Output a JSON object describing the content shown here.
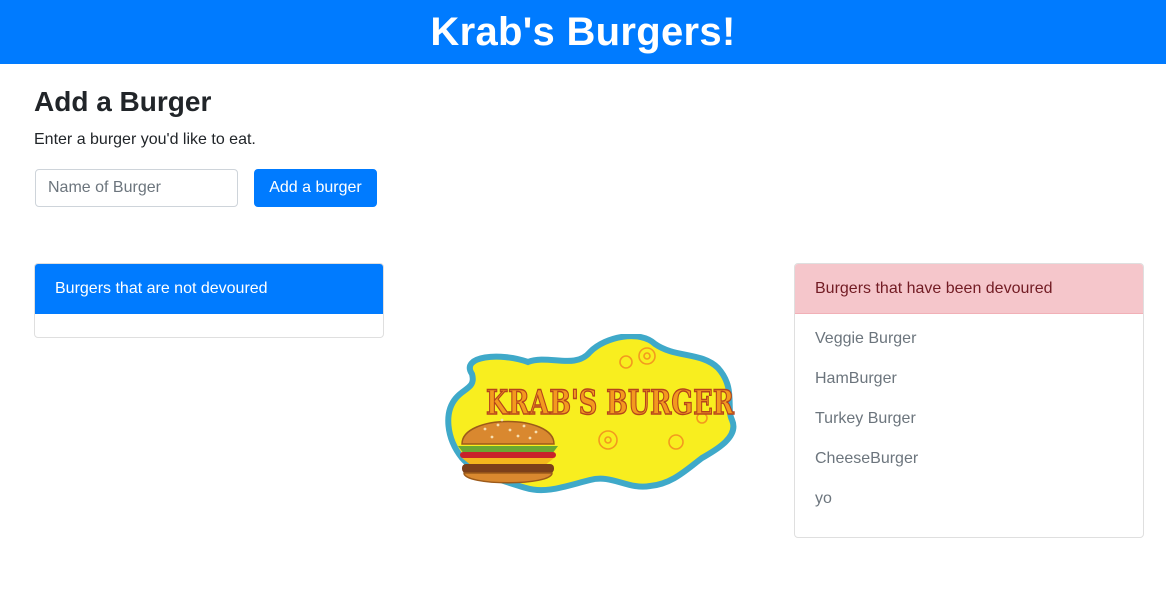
{
  "header": {
    "title": "Krab's Burgers!"
  },
  "add_section": {
    "heading": "Add a Burger",
    "description": "Enter a burger you'd like to eat.",
    "input_placeholder": "Name of Burger",
    "input_value": "",
    "button_label": "Add a burger"
  },
  "not_devoured": {
    "header": "Burgers that are not devoured",
    "items": []
  },
  "devoured": {
    "header": "Burgers that have been devoured",
    "items": [
      "Veggie Burger",
      "HamBurger",
      "Turkey Burger",
      "CheeseBurger",
      "yo"
    ]
  },
  "logo": {
    "text": "KRAB'S BURGER"
  },
  "colors": {
    "primary": "#007bff",
    "danger_bg": "#f5c6cb",
    "danger_text": "#721c24",
    "logo_yellow": "#f8ee1f",
    "logo_orange": "#f39a1e"
  }
}
